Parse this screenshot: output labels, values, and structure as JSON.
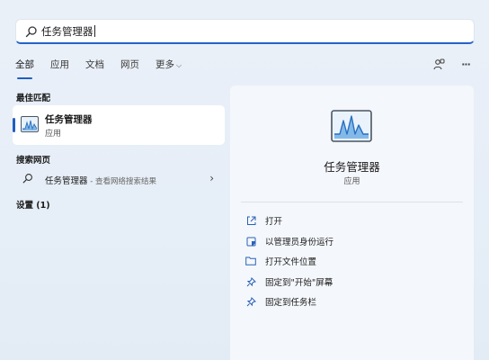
{
  "search": {
    "query": "任务管理器"
  },
  "tabs": [
    {
      "label": "全部"
    },
    {
      "label": "应用"
    },
    {
      "label": "文档"
    },
    {
      "label": "网页"
    },
    {
      "label": "更多",
      "chevron": "⌵"
    }
  ],
  "toolbar": {
    "share_icon": "share-icon",
    "more_label": "···"
  },
  "best_match": {
    "header": "最佳匹配",
    "name": "任务管理器",
    "type": "应用"
  },
  "web": {
    "header": "搜索网页",
    "query": "任务管理器",
    "suffix": " - 查看网络搜索结果",
    "arrow": "›"
  },
  "settings": {
    "header": "设置 (1)"
  },
  "details": {
    "title": "任务管理器",
    "type": "应用",
    "actions": [
      {
        "label": "打开",
        "icon": "open-icon"
      },
      {
        "label": "以管理员身份运行",
        "icon": "shield-icon"
      },
      {
        "label": "打开文件位置",
        "icon": "folder-icon"
      },
      {
        "label": "固定到\"开始\"屏幕",
        "icon": "pin-icon"
      },
      {
        "label": "固定到任务栏",
        "icon": "pin-icon"
      }
    ]
  },
  "colors": {
    "accent": "#1f5fbf",
    "panel": "#f4f7fb",
    "background": "#e8eff8"
  }
}
